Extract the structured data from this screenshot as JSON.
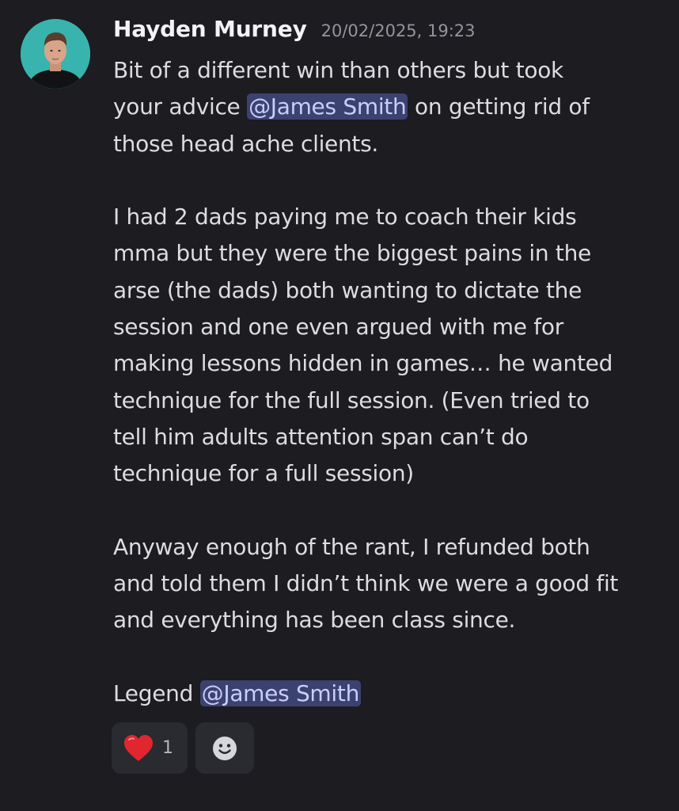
{
  "message": {
    "author": "Hayden Murney",
    "timestamp": "20/02/2025, 19:23",
    "lines": {
      "l1": "Bit of a different win than others but took",
      "l2_pre": "your advice ",
      "l2_mention": "@James Smith",
      "l2_post": " on getting rid of",
      "l3": "those head ache clients.",
      "l5": "I had 2 dads paying me to coach their kids",
      "l6": "mma but they were the biggest pains in the",
      "l7": "arse (the dads) both wanting to dictate the",
      "l8": "session and one even argued with me for",
      "l9": "making lessons hidden in games… he wanted",
      "l10": "technique for the full session. (Even tried to",
      "l11": "tell him adults attention span can’t do",
      "l12": "technique for a full session)",
      "l14": "Anyway enough of the rant, I refunded both",
      "l15": "and told them I didn’t think we were a good fit",
      "l16": "and everything has been class since.",
      "l18_pre": "Legend ",
      "l18_mention": "@James Smith"
    }
  },
  "reactions": [
    {
      "icon": "heart-icon",
      "emoji": "❤️",
      "count": "1"
    },
    {
      "icon": "add-reaction-smile-icon"
    }
  ],
  "colors": {
    "background": "#1c1c21",
    "mention_bg": "#3c4270",
    "mention_text": "#c9cdfb",
    "avatar_bg": "#39b3ad",
    "heart": "#e0262f"
  }
}
